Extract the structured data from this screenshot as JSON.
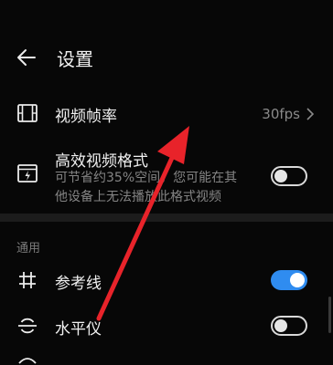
{
  "header": {
    "title": "设置"
  },
  "rows": {
    "frame_rate": {
      "label": "视频帧率",
      "value": "30fps"
    },
    "efficient": {
      "label": "高效视频格式",
      "sub1": "可节省约35%空间，您可能在其",
      "sub2": "他设备上无法播放此格式视频",
      "on": false
    },
    "grid": {
      "label": "参考线",
      "on": true
    },
    "level": {
      "label": "水平仪",
      "on": false
    }
  },
  "section": {
    "general": "通用"
  },
  "colors": {
    "accent": "#2f8cf0",
    "arrow": "#e8232a"
  }
}
